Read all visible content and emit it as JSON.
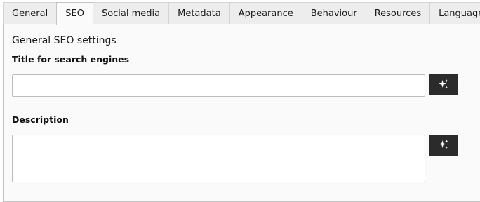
{
  "tabs": [
    {
      "label": "General",
      "active": false
    },
    {
      "label": "SEO",
      "active": true
    },
    {
      "label": "Social media",
      "active": false
    },
    {
      "label": "Metadata",
      "active": false
    },
    {
      "label": "Appearance",
      "active": false
    },
    {
      "label": "Behaviour",
      "active": false
    },
    {
      "label": "Resources",
      "active": false
    },
    {
      "label": "Language",
      "active": false
    }
  ],
  "seo": {
    "section_title": "General SEO settings",
    "title_field": {
      "label": "Title for search engines",
      "value": "",
      "button_icon": "sparkle-icon"
    },
    "description_field": {
      "label": "Description",
      "value": "",
      "button_icon": "sparkle-icon"
    }
  },
  "colors": {
    "button_bg": "#2b2b2b",
    "panel_bg": "#fafafa",
    "tab_bg": "#ededed"
  }
}
